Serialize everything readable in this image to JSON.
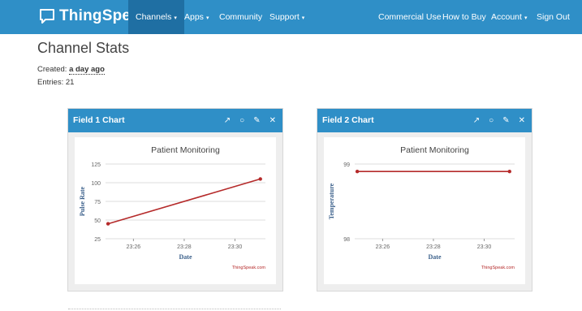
{
  "navbar": {
    "brand": "ThingSpeak",
    "brand_tm": "™",
    "items": [
      {
        "label": "Channels",
        "caret": "▾"
      },
      {
        "label": "Apps",
        "caret": "▾"
      },
      {
        "label": "Community"
      },
      {
        "label": "Support",
        "caret": "▾"
      },
      {
        "label": "Commercial Use"
      },
      {
        "label": "How to Buy"
      },
      {
        "label": "Account",
        "caret": "▾"
      },
      {
        "label": "Sign Out"
      }
    ]
  },
  "page": {
    "title": "Channel Stats",
    "created_label": "Created:",
    "created_value": "a day ago",
    "entries": "Entries: 21"
  },
  "colors": {
    "navbar": "#2f8fc7",
    "navbar_active": "#1f6fa3",
    "series_line": "#b52a2a"
  },
  "chart_data": [
    {
      "type": "line",
      "panel_title": "Field 1 Chart",
      "title": "Patient Monitoring",
      "xlabel": "Date",
      "ylabel": "Pulse Rate",
      "credit": "ThingSpeak.com",
      "x_ticks": [
        "23:26",
        "23:28",
        "23:30"
      ],
      "x_tick_minutes": [
        26,
        28,
        30
      ],
      "xlim_minutes": [
        24.9,
        31.2
      ],
      "y_ticks": [
        25,
        50,
        75,
        100,
        125
      ],
      "ylim": [
        25,
        125
      ],
      "series": [
        {
          "x_minutes": [
            25.0,
            31.0
          ],
          "values": [
            45,
            105
          ]
        }
      ],
      "grid": true
    },
    {
      "type": "line",
      "panel_title": "Field 2 Chart",
      "title": "Patient Monitoring",
      "xlabel": "Date",
      "ylabel": "Temperature",
      "credit": "ThingSpeak.com",
      "x_ticks": [
        "23:26",
        "23:28",
        "23:30"
      ],
      "x_tick_minutes": [
        26,
        28,
        30
      ],
      "xlim_minutes": [
        24.9,
        31.2
      ],
      "y_ticks": [
        98,
        99
      ],
      "ylim": [
        98,
        99
      ],
      "series": [
        {
          "x_minutes": [
            25.0,
            31.0
          ],
          "values": [
            98.9,
            98.9
          ]
        }
      ],
      "grid": true
    }
  ]
}
